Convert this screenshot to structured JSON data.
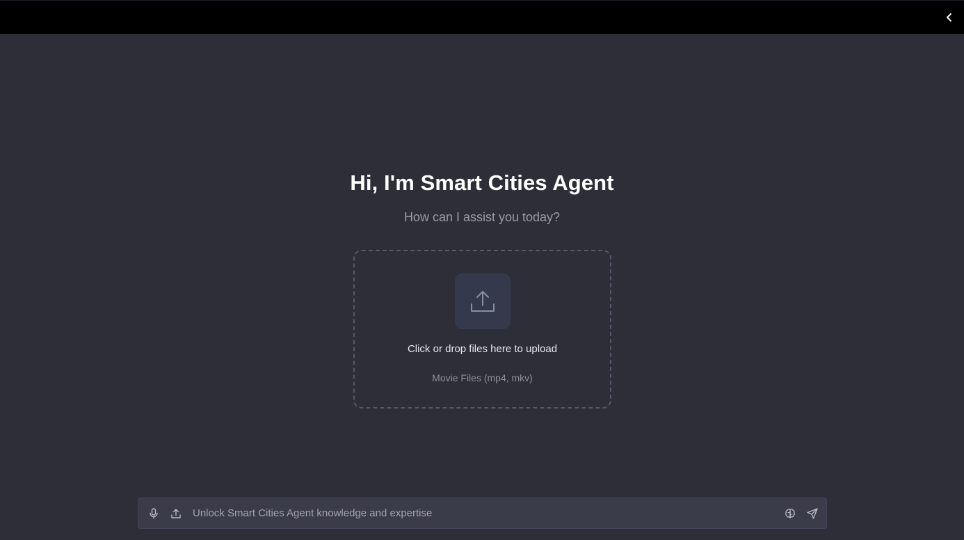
{
  "header": {
    "collapse_icon": "chevron-left-icon"
  },
  "welcome": {
    "title": "Hi, I'm Smart Cities Agent",
    "subtitle": "How can I assist you today?"
  },
  "upload": {
    "icon": "upload-icon",
    "title": "Click or drop files here to upload",
    "formats": "Movie Files (mp4, mkv)"
  },
  "composer": {
    "placeholder": "Unlock Smart Cities Agent knowledge and expertise",
    "value": "",
    "mic_icon": "microphone-icon",
    "attach_icon": "upload-icon",
    "brain_icon": "brain-icon",
    "send_icon": "send-icon"
  },
  "colors": {
    "background": "#2e2e38",
    "topbar": "#000000",
    "composer": "#3b3c49",
    "upload_tile": "#343a4c"
  }
}
